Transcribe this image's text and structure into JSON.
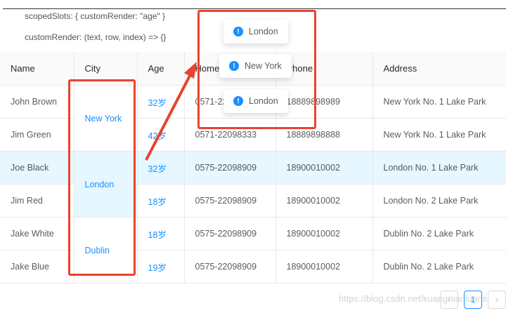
{
  "code": {
    "line1": "scopedSlots: { customRender: \"age\" }",
    "line2": "customRender: (text, row, index) => {}"
  },
  "columns": [
    "Name",
    "City",
    "Age",
    "Home phone",
    "Phone",
    "Address"
  ],
  "rows": [
    {
      "name": "John Brown",
      "age": "32岁",
      "tel": "0571-22098909",
      "phone": "18889898989",
      "address": "New York No. 1 Lake Park"
    },
    {
      "name": "Jim Green",
      "age": "42岁",
      "tel": "0571-22098333",
      "phone": "18889898888",
      "address": "New York No. 1 Lake Park"
    },
    {
      "name": "Joe Black",
      "age": "32岁",
      "tel": "0575-22098909",
      "phone": "18900010002",
      "address": "London No. 1 Lake Park"
    },
    {
      "name": "Jim Red",
      "age": "18岁",
      "tel": "0575-22098909",
      "phone": "18900010002",
      "address": "London No. 2 Lake Park"
    },
    {
      "name": "Jake White",
      "age": "18岁",
      "tel": "0575-22098909",
      "phone": "18900010002",
      "address": "Dublin No. 2 Lake Park"
    },
    {
      "name": "Jake Blue",
      "age": "19岁",
      "tel": "0575-22098909",
      "phone": "18900010002",
      "address": "Dublin No. 2 Lake Park"
    }
  ],
  "cities": [
    "New York",
    "London",
    "Dublin"
  ],
  "messages": [
    "London",
    "New York",
    "London"
  ],
  "pagination": {
    "current": "1",
    "prev": "‹",
    "next": "›"
  },
  "watermark": "https://blog.csdn.net/kuangnianluans",
  "colors": {
    "accent": "#1890ff",
    "annotation": "#e8432f"
  }
}
